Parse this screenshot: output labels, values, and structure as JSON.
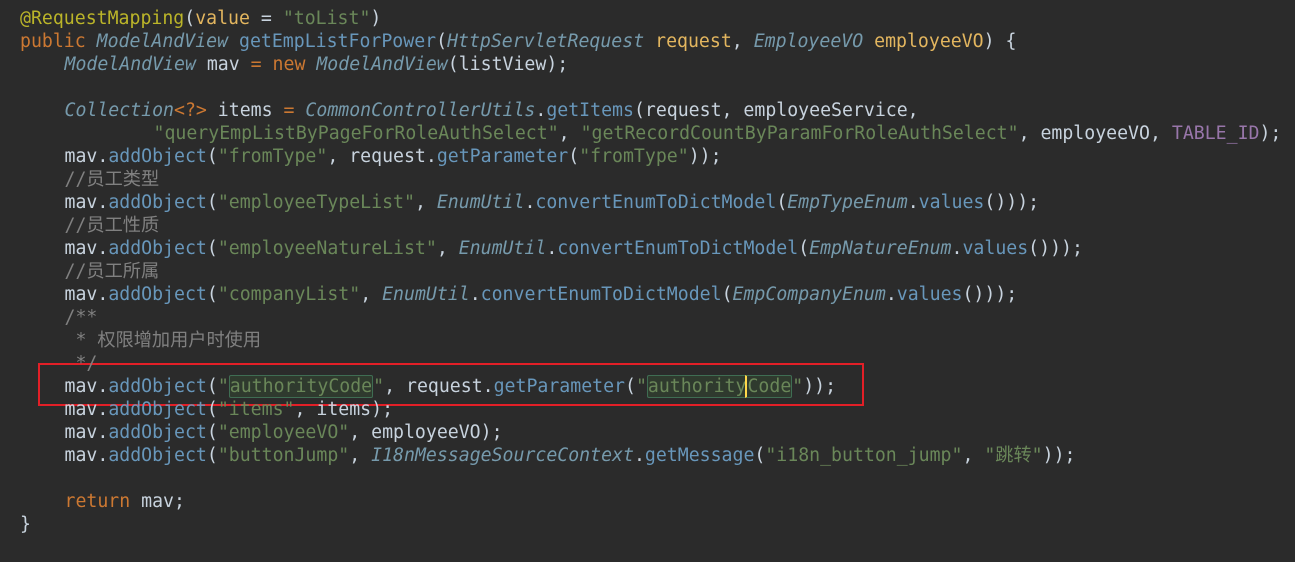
{
  "editor": {
    "lines": [
      {
        "id": "annotation",
        "indent": 0,
        "tokens": [
          {
            "t": "@RequestMapping",
            "c": "ann"
          },
          {
            "t": "(",
            "c": "plain"
          },
          {
            "t": "value",
            "c": "param"
          },
          {
            "t": " = ",
            "c": "plain"
          },
          {
            "t": "\"toList\"",
            "c": "str"
          },
          {
            "t": ")",
            "c": "plain"
          }
        ]
      },
      {
        "id": "method-signature",
        "indent": 0,
        "tokens": [
          {
            "t": "public ",
            "c": "kw"
          },
          {
            "t": "ModelAndView",
            "c": "type"
          },
          {
            "t": " getEmpListForPower",
            "c": "method"
          },
          {
            "t": "(",
            "c": "plain"
          },
          {
            "t": "HttpServletRequest",
            "c": "type"
          },
          {
            "t": " request",
            "c": "param"
          },
          {
            "t": ", ",
            "c": "plain"
          },
          {
            "t": "EmployeeVO",
            "c": "type"
          },
          {
            "t": " employeeVO",
            "c": "param"
          },
          {
            "t": ") {",
            "c": "plain"
          }
        ]
      },
      {
        "id": "mav-declaration",
        "indent": 1,
        "tokens": [
          {
            "t": "ModelAndView",
            "c": "type"
          },
          {
            "t": " mav ",
            "c": "plain"
          },
          {
            "t": "=",
            "c": "op"
          },
          {
            "t": " new ",
            "c": "kw"
          },
          {
            "t": "ModelAndView",
            "c": "type"
          },
          {
            "t": "(listView);",
            "c": "plain"
          }
        ]
      },
      {
        "id": "blank-1",
        "indent": 0,
        "tokens": []
      },
      {
        "id": "items-declaration",
        "indent": 1,
        "tokens": [
          {
            "t": "Collection",
            "c": "type"
          },
          {
            "t": "<?>",
            "c": "op"
          },
          {
            "t": " items ",
            "c": "plain"
          },
          {
            "t": "=",
            "c": "op"
          },
          {
            "t": " CommonControllerUtils",
            "c": "type"
          },
          {
            "t": ".",
            "c": "plain"
          },
          {
            "t": "getItems",
            "c": "method"
          },
          {
            "t": "(request, employeeService,",
            "c": "plain"
          }
        ]
      },
      {
        "id": "items-args",
        "indent": 3,
        "tokens": [
          {
            "t": "\"queryEmpListByPageForRoleAuthSelect\"",
            "c": "str"
          },
          {
            "t": ", ",
            "c": "plain"
          },
          {
            "t": "\"getRecordCountByParamForRoleAuthSelect\"",
            "c": "str"
          },
          {
            "t": ", employeeVO, ",
            "c": "plain"
          },
          {
            "t": "TABLE_ID",
            "c": "const"
          },
          {
            "t": ");",
            "c": "plain"
          }
        ]
      },
      {
        "id": "from-type",
        "indent": 1,
        "tokens": [
          {
            "t": "mav.",
            "c": "plain"
          },
          {
            "t": "addObject",
            "c": "method"
          },
          {
            "t": "(",
            "c": "plain"
          },
          {
            "t": "\"fromType\"",
            "c": "str"
          },
          {
            "t": ", request.",
            "c": "plain"
          },
          {
            "t": "getParameter",
            "c": "method"
          },
          {
            "t": "(",
            "c": "plain"
          },
          {
            "t": "\"fromType\"",
            "c": "str"
          },
          {
            "t": "));",
            "c": "plain"
          }
        ]
      },
      {
        "id": "comment-employee-type",
        "indent": 1,
        "tokens": [
          {
            "t": "//员工类型",
            "c": "comment"
          }
        ]
      },
      {
        "id": "employee-type-list",
        "indent": 1,
        "tokens": [
          {
            "t": "mav.",
            "c": "plain"
          },
          {
            "t": "addObject",
            "c": "method"
          },
          {
            "t": "(",
            "c": "plain"
          },
          {
            "t": "\"employeeTypeList\"",
            "c": "str"
          },
          {
            "t": ", ",
            "c": "plain"
          },
          {
            "t": "EnumUtil",
            "c": "type"
          },
          {
            "t": ".",
            "c": "plain"
          },
          {
            "t": "convertEnumToDictModel",
            "c": "method"
          },
          {
            "t": "(",
            "c": "plain"
          },
          {
            "t": "EmpTypeEnum",
            "c": "type"
          },
          {
            "t": ".",
            "c": "plain"
          },
          {
            "t": "values",
            "c": "method"
          },
          {
            "t": "()));",
            "c": "plain"
          }
        ]
      },
      {
        "id": "comment-employee-nature",
        "indent": 1,
        "tokens": [
          {
            "t": "//员工性质",
            "c": "comment"
          }
        ]
      },
      {
        "id": "employee-nature-list",
        "indent": 1,
        "tokens": [
          {
            "t": "mav.",
            "c": "plain"
          },
          {
            "t": "addObject",
            "c": "method"
          },
          {
            "t": "(",
            "c": "plain"
          },
          {
            "t": "\"employeeNatureList\"",
            "c": "str"
          },
          {
            "t": ", ",
            "c": "plain"
          },
          {
            "t": "EnumUtil",
            "c": "type"
          },
          {
            "t": ".",
            "c": "plain"
          },
          {
            "t": "convertEnumToDictModel",
            "c": "method"
          },
          {
            "t": "(",
            "c": "plain"
          },
          {
            "t": "EmpNatureEnum",
            "c": "type"
          },
          {
            "t": ".",
            "c": "plain"
          },
          {
            "t": "values",
            "c": "method"
          },
          {
            "t": "()));",
            "c": "plain"
          }
        ]
      },
      {
        "id": "comment-employee-company",
        "indent": 1,
        "tokens": [
          {
            "t": "//员工所属",
            "c": "comment"
          }
        ]
      },
      {
        "id": "company-list",
        "indent": 1,
        "tokens": [
          {
            "t": "mav.",
            "c": "plain"
          },
          {
            "t": "addObject",
            "c": "method"
          },
          {
            "t": "(",
            "c": "plain"
          },
          {
            "t": "\"companyList\"",
            "c": "str"
          },
          {
            "t": ", ",
            "c": "plain"
          },
          {
            "t": "EnumUtil",
            "c": "type"
          },
          {
            "t": ".",
            "c": "plain"
          },
          {
            "t": "convertEnumToDictModel",
            "c": "method"
          },
          {
            "t": "(",
            "c": "plain"
          },
          {
            "t": "EmpCompanyEnum",
            "c": "type"
          },
          {
            "t": ".",
            "c": "plain"
          },
          {
            "t": "values",
            "c": "method"
          },
          {
            "t": "()));",
            "c": "plain"
          }
        ]
      },
      {
        "id": "doc-comment-open",
        "indent": 1,
        "tokens": [
          {
            "t": "/**",
            "c": "comment"
          }
        ]
      },
      {
        "id": "doc-comment-body",
        "indent": 1,
        "tokens": [
          {
            "t": " * 权限增加用户时使用",
            "c": "comment"
          }
        ]
      },
      {
        "id": "doc-comment-close",
        "indent": 1,
        "tokens": [
          {
            "t": " */",
            "c": "comment"
          }
        ]
      },
      {
        "id": "authority-code",
        "indent": 1,
        "tokens": [
          {
            "t": "mav.",
            "c": "plain"
          },
          {
            "t": "addObject",
            "c": "method"
          },
          {
            "t": "(",
            "c": "plain"
          },
          {
            "t": "\"",
            "c": "str"
          },
          {
            "t": "authorityCode",
            "c": "str",
            "hl": true
          },
          {
            "t": "\"",
            "c": "str"
          },
          {
            "t": ", request.",
            "c": "plain"
          },
          {
            "t": "getParameter",
            "c": "method"
          },
          {
            "t": "(",
            "c": "plain"
          },
          {
            "t": "\"",
            "c": "str"
          },
          {
            "t": "authority",
            "c": "str",
            "hl": true,
            "hlStart": true
          },
          {
            "t": "Code",
            "c": "str",
            "hl": true,
            "hlEnd": true,
            "cursor": true
          },
          {
            "t": "\"",
            "c": "str"
          },
          {
            "t": "));",
            "c": "plain"
          }
        ]
      },
      {
        "id": "items",
        "indent": 1,
        "tokens": [
          {
            "t": "mav.",
            "c": "plain"
          },
          {
            "t": "addObject",
            "c": "method"
          },
          {
            "t": "(",
            "c": "plain"
          },
          {
            "t": "\"items\"",
            "c": "str"
          },
          {
            "t": ", items);",
            "c": "plain"
          }
        ]
      },
      {
        "id": "employee-vo",
        "indent": 1,
        "tokens": [
          {
            "t": "mav.",
            "c": "plain"
          },
          {
            "t": "addObject",
            "c": "method"
          },
          {
            "t": "(",
            "c": "plain"
          },
          {
            "t": "\"employeeVO\"",
            "c": "str"
          },
          {
            "t": ", employeeVO);",
            "c": "plain"
          }
        ]
      },
      {
        "id": "button-jump",
        "indent": 1,
        "tokens": [
          {
            "t": "mav.",
            "c": "plain"
          },
          {
            "t": "addObject",
            "c": "method"
          },
          {
            "t": "(",
            "c": "plain"
          },
          {
            "t": "\"buttonJump\"",
            "c": "str"
          },
          {
            "t": ", ",
            "c": "plain"
          },
          {
            "t": "I18nMessageSourceContext",
            "c": "type"
          },
          {
            "t": ".",
            "c": "plain"
          },
          {
            "t": "getMessage",
            "c": "method"
          },
          {
            "t": "(",
            "c": "plain"
          },
          {
            "t": "\"i18n_button_jump\"",
            "c": "str"
          },
          {
            "t": ", ",
            "c": "plain"
          },
          {
            "t": "\"跳转\"",
            "c": "str"
          },
          {
            "t": "));",
            "c": "plain"
          }
        ]
      },
      {
        "id": "blank-2",
        "indent": 0,
        "tokens": []
      },
      {
        "id": "return",
        "indent": 1,
        "tokens": [
          {
            "t": "return ",
            "c": "kw"
          },
          {
            "t": "mav;",
            "c": "plain"
          }
        ]
      },
      {
        "id": "closing-brace",
        "indent": 0,
        "tokens": [
          {
            "t": "}",
            "c": "plain"
          }
        ]
      }
    ],
    "highlight_line": "authority-code",
    "colors": {
      "background": "#2b2b2b",
      "annotation": "#bbb529",
      "keyword": "#cc7832",
      "type": "#769aac",
      "parameter": "#e3b65f",
      "method": "#6897bb",
      "string": "#6a8759",
      "comment": "#808080",
      "plain": "#c8d3de",
      "constant": "#9876aa",
      "highlight_box": "#e21f27",
      "cursor": "#ffd84a"
    }
  }
}
